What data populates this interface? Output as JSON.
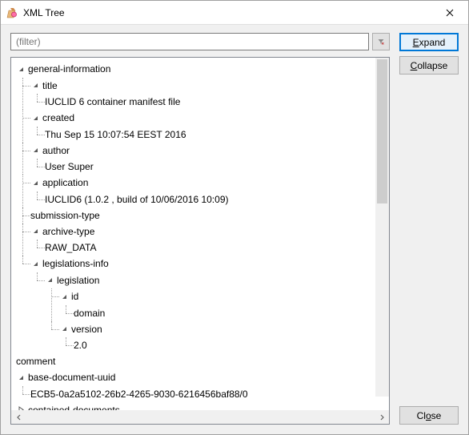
{
  "window": {
    "title": "XML Tree"
  },
  "filter": {
    "placeholder": "(filter)"
  },
  "buttons": {
    "expand": "Expand",
    "collapse": "Collapse",
    "close": "Close"
  },
  "tree": {
    "n0": "general-information",
    "n0_0": "title",
    "n0_0_0": "IUCLID 6 container manifest file",
    "n0_1": "created",
    "n0_1_0": "Thu Sep 15 10:07:54 EEST 2016",
    "n0_2": "author",
    "n0_2_0": "User Super",
    "n0_3": "application",
    "n0_3_0": "IUCLID6 (1.0.2 , build of 10/06/2016 10:09)",
    "n0_4": "submission-type",
    "n0_5": "archive-type",
    "n0_5_0": "RAW_DATA",
    "n0_6": "legislations-info",
    "n0_6_0": "legislation",
    "n0_6_0_0": "id",
    "n0_6_0_0_0": "domain",
    "n0_6_0_1": "version",
    "n0_6_0_1_0": "2.0",
    "n1": "comment",
    "n2": "base-document-uuid",
    "n2_0": "ECB5-0a2a5102-26b2-4265-9030-6216456baf88/0",
    "n3": "contained-documents"
  }
}
